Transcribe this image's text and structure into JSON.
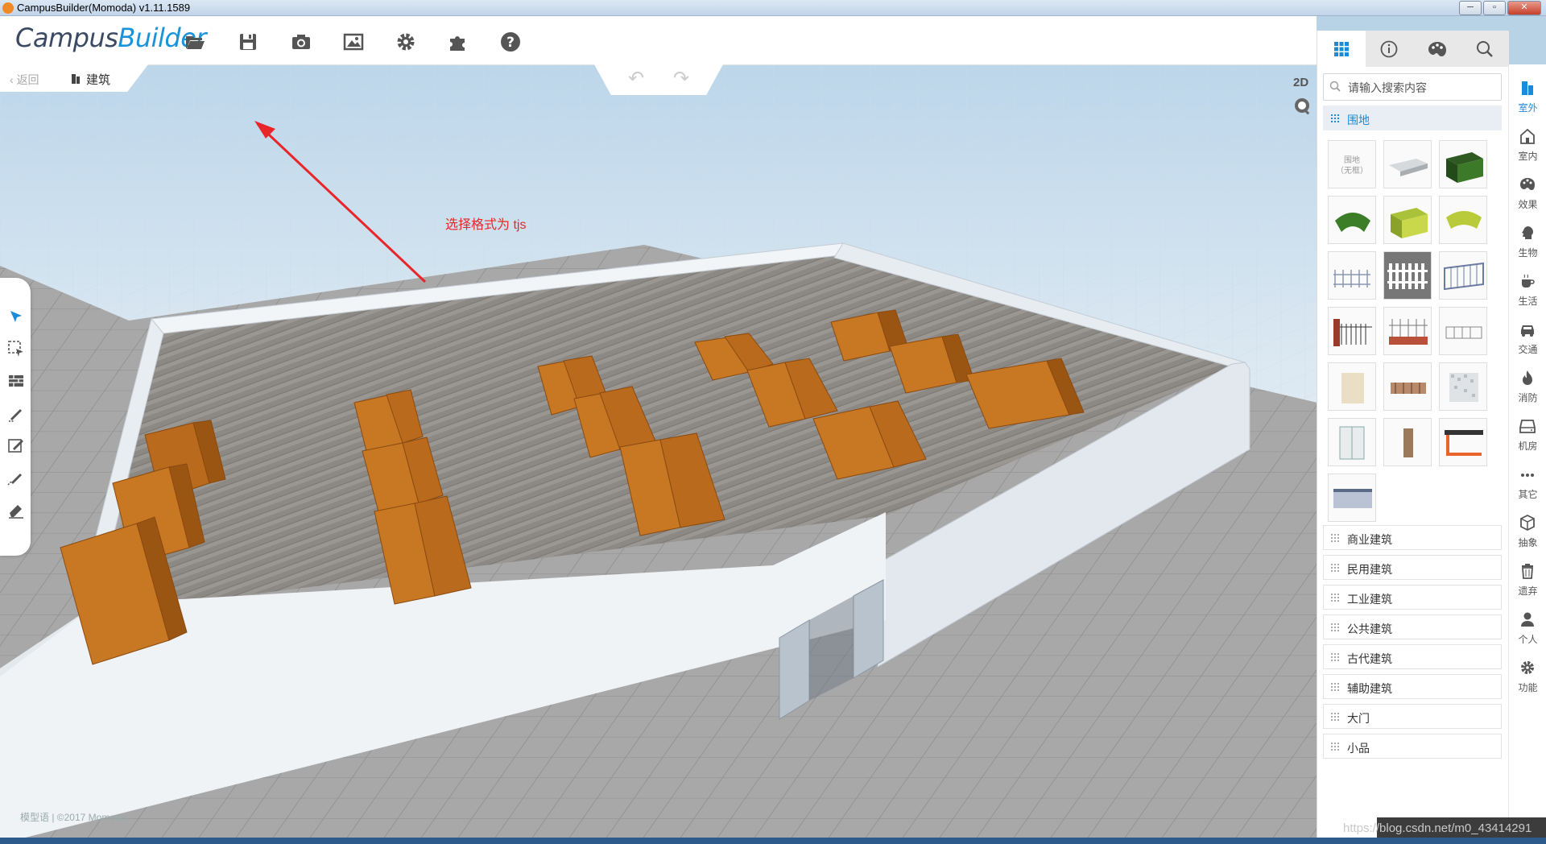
{
  "window": {
    "title": "CampusBuilder(Momoda) v1.11.1589",
    "controls": [
      "─",
      "▫",
      "✕"
    ]
  },
  "toolbar": {
    "logo_part1": "Campus",
    "logo_part2": "Builder",
    "buttons": [
      {
        "name": "open-folder-icon"
      },
      {
        "name": "save-icon"
      },
      {
        "name": "camera-icon"
      },
      {
        "name": "image-icon"
      },
      {
        "name": "gear-icon"
      },
      {
        "name": "puzzle-icon"
      },
      {
        "name": "help-icon"
      }
    ]
  },
  "nav": {
    "back_label": "返回",
    "breadcrumb": "建筑"
  },
  "history": {
    "undo_icon": "undo-icon",
    "redo_icon": "redo-icon"
  },
  "view": {
    "mode_label": "2D"
  },
  "annotation": {
    "text": "选择格式为 tjs"
  },
  "panel": {
    "tabs": [
      "grid-icon",
      "info-icon",
      "palette-icon",
      "search-icon"
    ],
    "search_placeholder": "请输入搜索内容",
    "open_category": "围地",
    "thumb_label_top": "围地",
    "thumb_label_bottom": "（无框）",
    "categories": [
      "商业建筑",
      "民用建筑",
      "工业建筑",
      "公共建筑",
      "古代建筑",
      "辅助建筑",
      "大门",
      "小品"
    ]
  },
  "sidebar": {
    "items": [
      "室外",
      "室内",
      "效果",
      "生物",
      "生活",
      "交通",
      "消防",
      "机房",
      "其它",
      "抽象",
      "遗弃",
      "个人",
      "功能"
    ]
  },
  "footer": {
    "copyright": "模型语 | ©2017 Momoda",
    "watermark": "https://blog.csdn.net/m0_43414291"
  },
  "colors": {
    "accent": "#1a93d8",
    "annotation": "#e8262a",
    "shelf": "#c87822",
    "floor": "#8e8a86",
    "wall": "#eef2f6"
  }
}
